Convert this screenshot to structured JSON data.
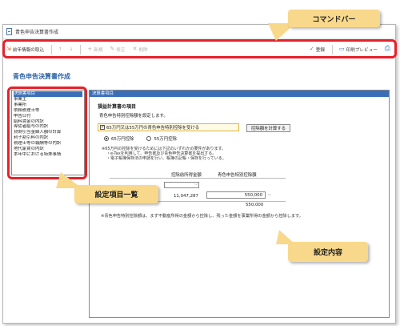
{
  "window": {
    "title": "青色申告決算書作成"
  },
  "toolbar": {
    "import_label": "前年情報の取込",
    "up_label": "↑",
    "down_label": "↓",
    "new_label": "新規",
    "edit_label": "修正",
    "delete_label": "削除",
    "register_label": "登録",
    "preview_label": "印刷プレビュー"
  },
  "callouts": {
    "command_bar": "コマンドバー",
    "settings_list": "設定項目一覧",
    "settings_content": "設定内容"
  },
  "page": {
    "heading": "青色申告決算書作成"
  },
  "settings_items": [
    "決算書項目",
    "事業主",
    "事業所",
    "依頼税理士等",
    "申告日付",
    "給料賃金の内訳",
    "専従者給与の内訳",
    "貸倒引当金繰入額の計算",
    "利子割引料の内訳",
    "税理士等の報酬等の内訳",
    "地代家賃の内訳",
    "本年中における特殊事情"
  ],
  "panel": {
    "header": "決算書項目",
    "section_title": "損益計算書の項目",
    "section_desc": "青色申告特別控除額を設定します。",
    "checkbox_label": "65万円又は55万円の青色申告特別控除を受ける",
    "calc_button": "控除額を計算する",
    "radio_65": "65万円控除",
    "radio_55": "55万円控除",
    "notes": [
      "※65万円の控除を受けるためには下記のいずれかの要件があります。",
      "・e-Taxを利用して、申告書及び青色申告決算書を提出する。",
      "・電子帳簿保存法の申請を行い、帳簿の記帳・保存を行っている。"
    ],
    "col_before": "控除前所得金額",
    "col_deduction": "青色申告特別控除額",
    "amount_before": "11,047,287",
    "amount_deduction": "550,000",
    "amount_total": "550,000",
    "footnote": "※青色申告特別控除額は、まず不動産所得の金額から控除し、残った金額を事業所得の金額から控除します。"
  }
}
